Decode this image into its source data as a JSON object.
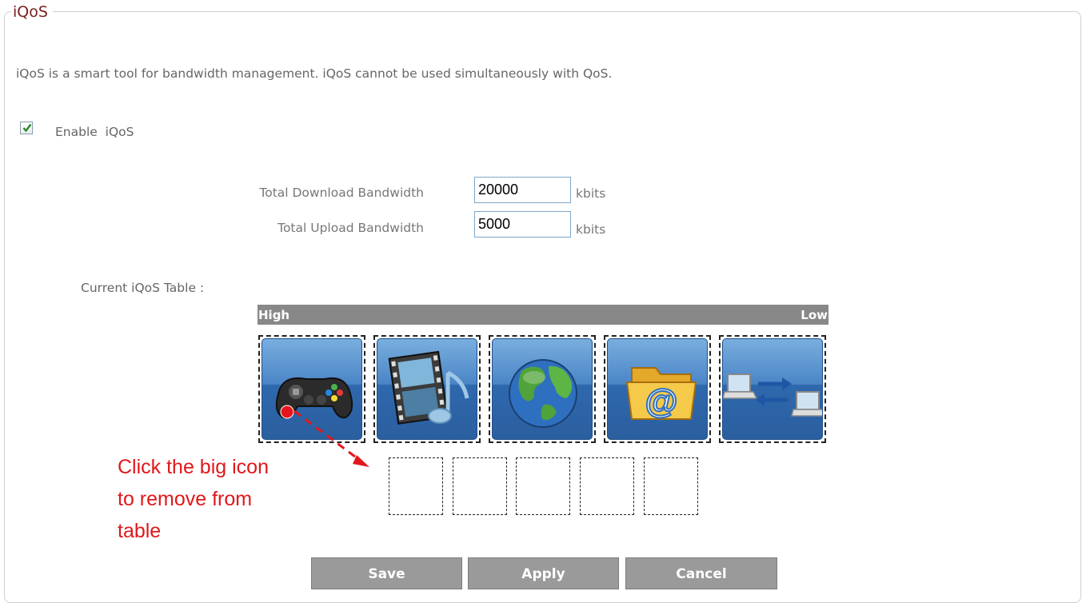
{
  "panel": {
    "legend": "iQoS",
    "description": "iQoS is a smart tool for bandwidth management. iQoS cannot be used simultaneously with QoS."
  },
  "enable": {
    "label": "Enable  iQoS",
    "checked": true
  },
  "bandwidth": {
    "download_label": "Total Download Bandwidth",
    "download_value": "20000",
    "upload_label": "Total Upload Bandwidth",
    "upload_value": "5000",
    "unit": "kbits"
  },
  "table": {
    "title": "Current iQoS Table :",
    "high_label": "High",
    "low_label": "Low",
    "icons": [
      "gamepad-icon",
      "media-film-music-icon",
      "globe-icon",
      "email-folder-icon",
      "p2p-computers-icon"
    ],
    "empty_slots": 5
  },
  "annotation": {
    "lines": [
      "Click the big icon",
      "to remove from",
      "table"
    ],
    "color": "#e0181b"
  },
  "buttons": {
    "save": "Save",
    "apply": "Apply",
    "cancel": "Cancel"
  },
  "colors": {
    "legend": "#7a1f1f",
    "bar": "#888888",
    "button": "#9a9a9a",
    "tile": "#3a74b8"
  }
}
